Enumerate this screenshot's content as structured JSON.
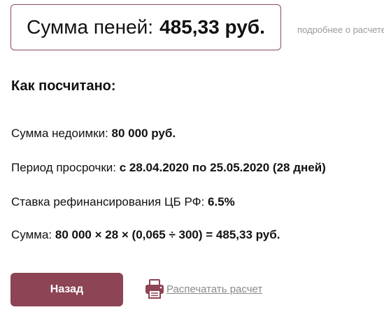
{
  "result": {
    "label": "Сумма пеней:",
    "value": "485,33 руб."
  },
  "details_link": "подробнее о расчете",
  "section_title": "Как посчитано:",
  "rows": [
    {
      "label": "Сумма недоимки: ",
      "value": "80 000 руб."
    },
    {
      "label": "Период просрочки: ",
      "value": "с 28.04.2020 по 25.05.2020 (28 дней)"
    },
    {
      "label": "Ставка рефинансирования ЦБ РФ: ",
      "value": "6.5%"
    },
    {
      "label": "Сумма: ",
      "value": "80 000 × 28 × (0,065 ÷ 300) = 485,33 руб."
    }
  ],
  "back_button": "Назад",
  "print_link": "Распечатать расчет",
  "icons": {
    "print": "printer-icon"
  },
  "colors": {
    "accent": "#8d4455",
    "border": "#8d4a58",
    "muted_text": "#9a9a9a"
  }
}
